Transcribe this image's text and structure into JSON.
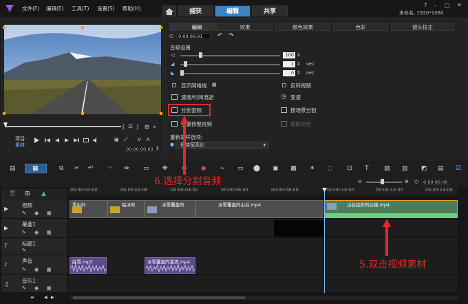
{
  "app": {
    "menu": [
      "文件(F)",
      "编辑(E)",
      "工具(T)",
      "设置(S)",
      "帮助(H)"
    ],
    "tabs": [
      {
        "label": "捕获",
        "active": false
      },
      {
        "label": "编辑",
        "active": true
      },
      {
        "label": "共享",
        "active": false
      }
    ],
    "project_info": "未命名, 1920*1080",
    "accent": "#3a84c4"
  },
  "player": {
    "project_label": "项目-",
    "clip_label": "素材-",
    "timecode": "00:00:00:00",
    "timecode2": "00:00:00:00",
    "video_label": "V",
    "audio_label": "A"
  },
  "options": {
    "tabs": [
      {
        "label": "编辑",
        "active": true
      },
      {
        "label": "效果",
        "active": false
      },
      {
        "label": "颜色效果",
        "active": false
      },
      {
        "label": "色彩",
        "active": false
      },
      {
        "label": "镜头校正",
        "active": false
      }
    ],
    "duration": "0:00:06:01",
    "audio_settings_title": "音频设置",
    "volume": "100",
    "fade_in": "1",
    "fade_out": "0",
    "sec_unit": "sec",
    "show_grid": "显示网格线",
    "reverse": "反转视频",
    "speed_time_lapse": "速度/时间流逝",
    "variable_speed": "变速",
    "split_audio": "分割音频",
    "scene_split": "按场景分割",
    "multi_trim": "多重修整视频",
    "smart_proxy": "智能项目",
    "resample_title": "重新采样选项:",
    "resample_value": "保持宽高比"
  },
  "timeline": {
    "ruler": [
      "00:00:00:00",
      "00:00:02:00",
      "00:00:04:00",
      "00:00:06:00",
      "00:00:08:00",
      "00:00:10:00",
      "00:00:12:00",
      "00:00:14:00"
    ],
    "zoom_timecode": "0:00:00:00",
    "tracks": [
      "视频",
      "覆叠1",
      "标题1",
      "声音",
      "音乐1"
    ],
    "video_clips": [
      {
        "label": "雪中行"
      },
      {
        "label": "临冰的"
      },
      {
        "label": "冰雪覆盖的"
      },
      {
        "label": "冰雪覆盖的山谷.mp4"
      },
      {
        "label": "山谷远处的公路.mp4"
      }
    ],
    "audio_clips": [
      {
        "label": "踩雪.mp3"
      },
      {
        "label": "冰雪覆盖的溪流.mp4"
      }
    ]
  },
  "annotations": {
    "step6": "6.选择分割音频",
    "step5": "5.双击视频素材"
  }
}
